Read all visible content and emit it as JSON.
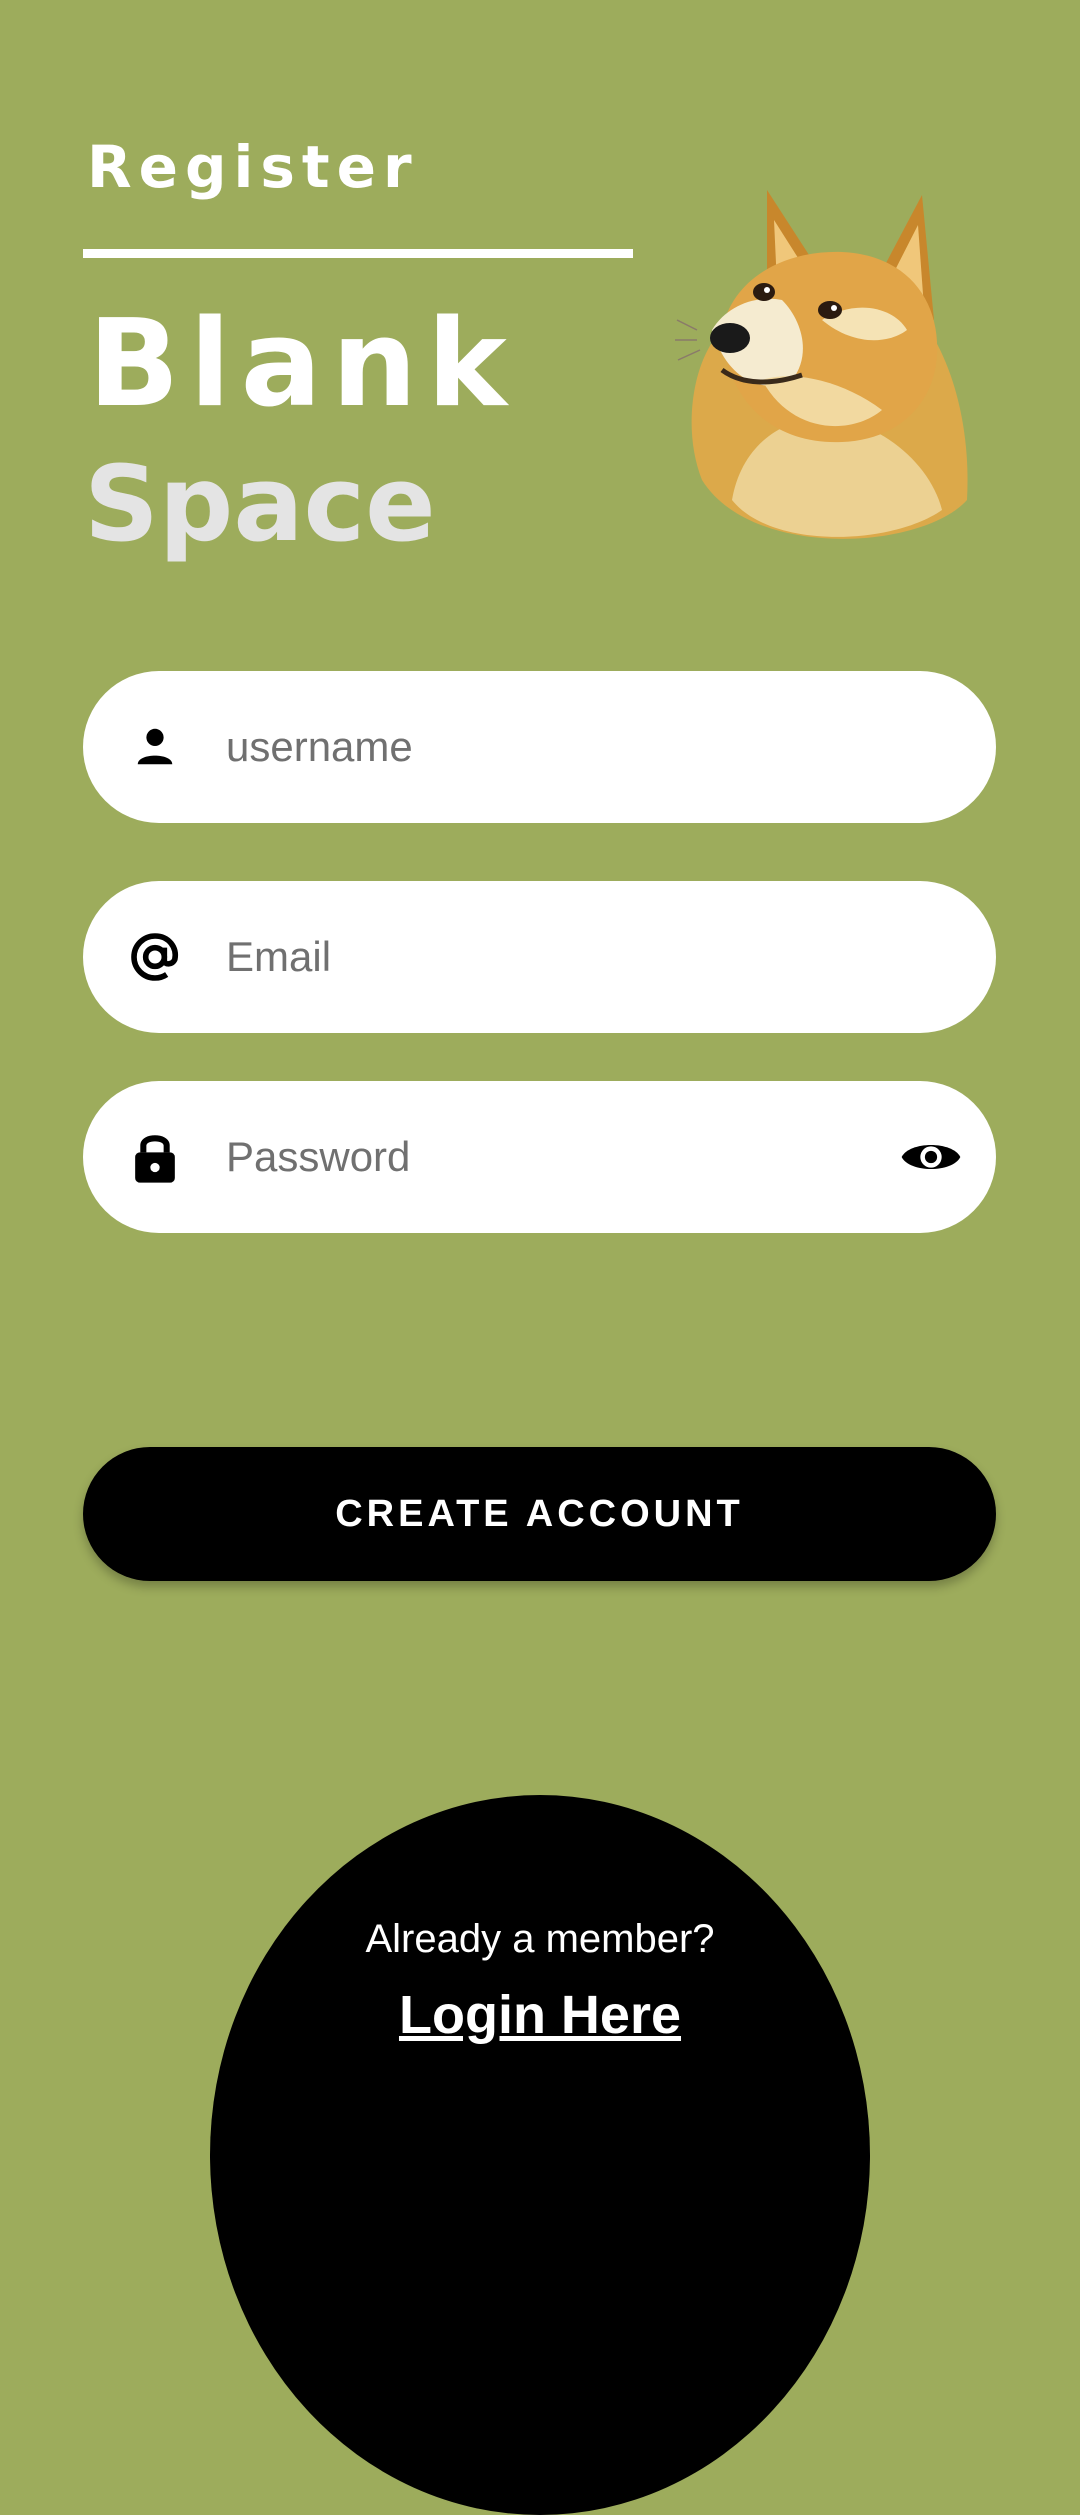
{
  "header": {
    "register_label": "Register",
    "title_line1": "Blank",
    "title_line2": "Space"
  },
  "form": {
    "username": {
      "placeholder": "username",
      "icon": "person-icon"
    },
    "email": {
      "placeholder": "Email",
      "icon": "at-icon"
    },
    "password": {
      "placeholder": "Password",
      "icon": "lock-icon",
      "toggle_icon": "eye-icon"
    }
  },
  "actions": {
    "create_account_label": "CREATE ACCOUNT"
  },
  "footer": {
    "member_text": "Already a member?",
    "login_label": "Login Here"
  },
  "colors": {
    "background": "#9dac5c",
    "button": "#000000",
    "field": "#ffffff"
  }
}
